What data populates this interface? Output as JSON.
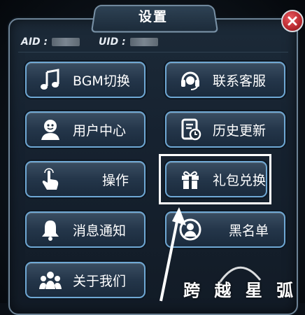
{
  "dialog": {
    "title": "设置",
    "aid_label": "AID :",
    "uid_label": "UID :"
  },
  "buttons": {
    "bgm": "BGM切换",
    "support": "联系客服",
    "user_center": "用户中心",
    "history": "历史更新",
    "controls": "操作",
    "gift": "礼包兑换",
    "messages": "消息通知",
    "blacklist": "黑名单",
    "about": "关于我们"
  },
  "watermark": "跨 越 星 弧",
  "colors": {
    "button_border": "#6fa8d4",
    "close_red": "#c8323a"
  },
  "icons": [
    "music-note-icon",
    "headset-icon",
    "user-face-icon",
    "document-clock-icon",
    "tap-hand-icon",
    "gift-box-icon",
    "bell-icon",
    "blocked-user-icon",
    "group-icon",
    "close-icon"
  ]
}
